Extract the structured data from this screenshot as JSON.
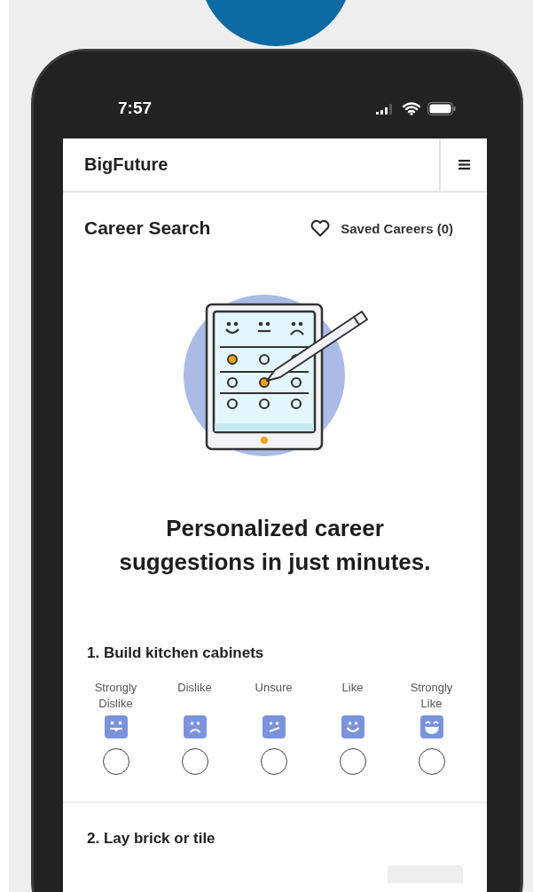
{
  "status_bar": {
    "time": "7:57"
  },
  "app_header": {
    "brand": "BigFuture"
  },
  "page": {
    "title": "Career Search",
    "saved_link": "Saved Careers (0)"
  },
  "headline": "Personalized career suggestions in just minutes.",
  "questions": [
    {
      "text": "1. Build kitchen cabinets",
      "options": [
        {
          "label": "Strongly Dislike",
          "kind": "dizzy",
          "selected": false
        },
        {
          "label": "Dislike",
          "kind": "sad",
          "selected": false
        },
        {
          "label": "Unsure",
          "kind": "unsure",
          "selected": false
        },
        {
          "label": "Like",
          "kind": "smile",
          "selected": false
        },
        {
          "label": "Strongly Like",
          "kind": "grin",
          "selected": false
        }
      ]
    },
    {
      "text": "2. Lay brick or tile"
    }
  ]
}
